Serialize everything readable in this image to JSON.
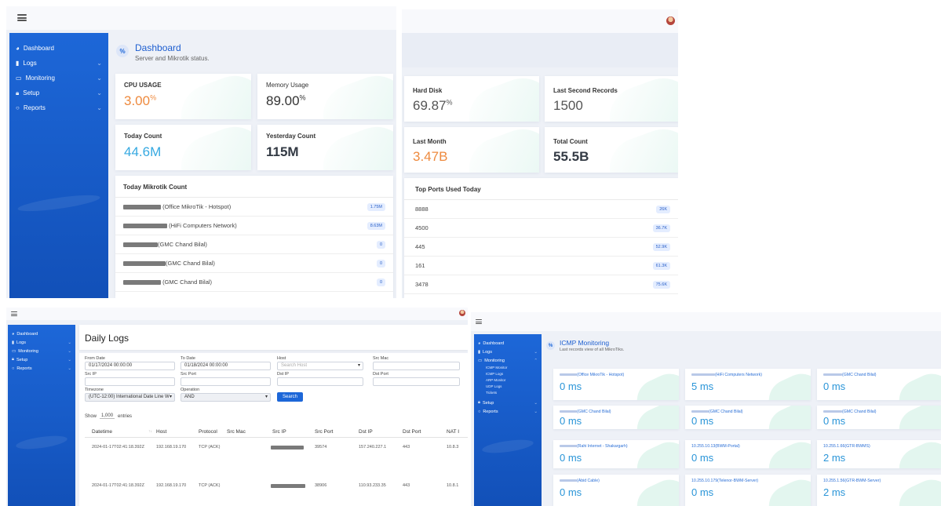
{
  "sidebar": {
    "items": [
      {
        "label": "Dashboard",
        "icon": "dashboard-icon",
        "chevron": false
      },
      {
        "label": "Logs",
        "icon": "logs-icon",
        "chevron": true
      },
      {
        "label": "Monitoring",
        "icon": "monitor-icon",
        "chevron": true
      },
      {
        "label": "Setup",
        "icon": "lock-icon",
        "chevron": true
      },
      {
        "label": "Reports",
        "icon": "reports-icon",
        "chevron": true
      }
    ],
    "monitoring_sub": [
      "ICMP Monitor",
      "ICMP Logs",
      "ARP Monitor",
      "UDP Logs",
      "Tickets"
    ]
  },
  "dashboard": {
    "title": "Dashboard",
    "subtitle": "Server and Mikrotik status.",
    "cards": [
      {
        "label": "CPU USAGE",
        "value": "3.00",
        "suffix": "%",
        "color": "#ee8a3e"
      },
      {
        "label": "Memory Usage",
        "value": "89.00",
        "suffix": "%",
        "color": "#333333"
      },
      {
        "label": "Today Count",
        "value": "44.6M",
        "suffix": "",
        "color": "#36a9e1"
      },
      {
        "label": "Yesterday Count",
        "value": "115M",
        "suffix": "",
        "color": "#333a44"
      },
      {
        "label": "Hard Disk",
        "value": "69.87",
        "suffix": "%",
        "color": "#555555"
      },
      {
        "label": "Last Second Records",
        "value": "1500",
        "suffix": "",
        "color": "#555555"
      },
      {
        "label": "Last Month",
        "value": "3.47B",
        "suffix": "",
        "color": "#ee8a3e"
      },
      {
        "label": "Total Count",
        "value": "55.5B",
        "suffix": "",
        "color": "#333a44"
      }
    ],
    "mikrotik": {
      "title": "Today Mikrotik Count",
      "rows": [
        {
          "name": "(Office MikroTik - Hotspot)",
          "count": "1.75M"
        },
        {
          "name": "(HiFi Computers Network)",
          "count": "8.63M"
        },
        {
          "name": "(GMC Chand Bilal)",
          "count": "0"
        },
        {
          "name": "(GMC Chand Bilal)",
          "count": "0"
        },
        {
          "name": "(GMC Chand Bilal)",
          "count": "0"
        }
      ]
    },
    "ports": {
      "title": "Top Ports Used Today",
      "rows": [
        {
          "port": "8888",
          "count": "26K"
        },
        {
          "port": "4500",
          "count": "36.7K"
        },
        {
          "port": "445",
          "count": "52.9K"
        },
        {
          "port": "161",
          "count": "61.3K"
        },
        {
          "port": "3478",
          "count": "75.6K"
        }
      ]
    }
  },
  "logs": {
    "title": "Daily Logs",
    "filters": {
      "from_label": "From Date",
      "from_value": "01/17/2024 00:00:00",
      "to_label": "To Date",
      "to_value": "01/18/2024 00:00:00",
      "host_label": "Host",
      "host_placeholder": "Search Host",
      "src_mac_label": "Src Mac",
      "src_ip_label": "Src IP",
      "src_port_label": "Src Port",
      "dst_ip_label": "Dst IP",
      "dst_port_label": "Dst Port",
      "timezone_label": "Timezone",
      "timezone_value": "(UTC-12:00) International Date Line W",
      "operation_label": "Operation",
      "operation_value": "AND",
      "search_label": "Search"
    },
    "show_label": "Show",
    "show_value": "1,000",
    "entries_label": "entries",
    "columns": [
      "Datetime",
      "Host",
      "Protocol",
      "Src Mac",
      "Src IP",
      "Src Port",
      "Dst IP",
      "Dst Port",
      "NAT I"
    ],
    "rows": [
      {
        "datetime": "2024-01-17T02:41:18.392Z",
        "host": "192.168.19.170",
        "protocol": "TCP (ACK)",
        "src_port": "39574",
        "dst_ip": "157.240.227.1",
        "dst_port": "443",
        "nat": "10.8.3"
      },
      {
        "datetime": "2024-01-17T02:41:18.392Z",
        "host": "192.168.19.170",
        "protocol": "TCP (ACK)",
        "src_port": "38906",
        "dst_ip": "110.93.233.35",
        "dst_port": "443",
        "nat": "10.8.1"
      }
    ]
  },
  "icmp": {
    "title": "ICMP Monitoring",
    "subtitle": "Last records view of all MikroTiks.",
    "cards": [
      {
        "name": "(Office MikroTik - Hotspot)",
        "value": "0 ms"
      },
      {
        "name": "(HiFi Computers Network)",
        "value": "5 ms"
      },
      {
        "name": "(GMC Chand Bilal)",
        "value": "0 ms"
      },
      {
        "name": "(GMC Chand Bilal)",
        "value": "0 ms"
      },
      {
        "name": "(GMC Chand Bilal)",
        "value": "0 ms"
      },
      {
        "name": "(GMC Chand Bilal)",
        "value": "0 ms"
      },
      {
        "name": "(Rahi Internet - Shakargarh)",
        "value": "0 ms"
      },
      {
        "name": "10.255.10.13(BWM-Portal)",
        "value": "0 ms"
      },
      {
        "name": "10.255.1.66(GTR-BWMS)",
        "value": "2 ms"
      },
      {
        "name": "(Abid Cable)",
        "value": "0 ms"
      },
      {
        "name": "10.255.10.179(Telenor-BWM-Server)",
        "value": "0 ms"
      },
      {
        "name": "10.255.1.56(GTR-BWM-Server)",
        "value": "2 ms"
      }
    ]
  }
}
